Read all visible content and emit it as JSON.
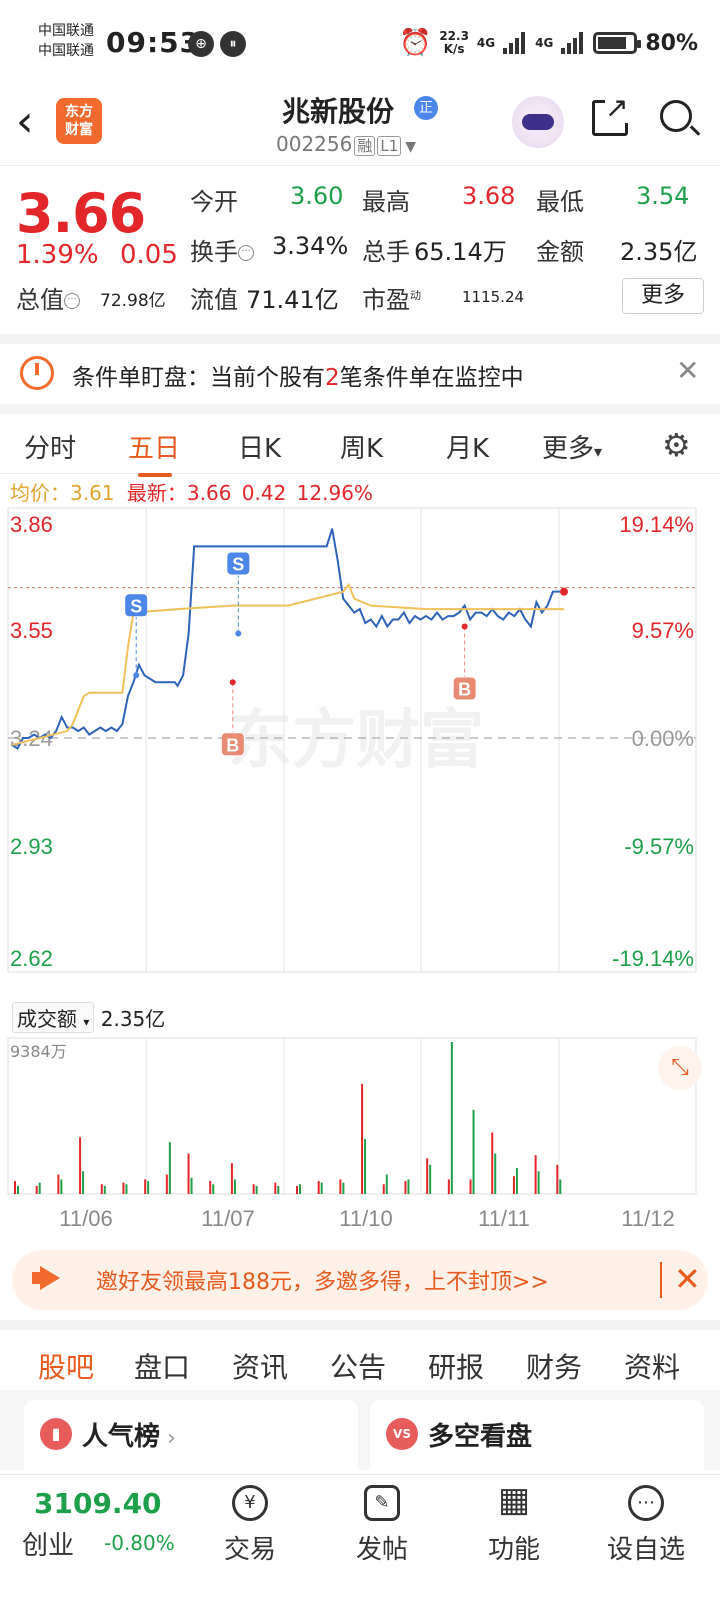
{
  "status_bar": {
    "carrier1": "中国联通",
    "carrier2": "中国联通",
    "time": "09:53",
    "net_speed": "22.3",
    "net_unit": "K/s",
    "sig1": "4G",
    "sig2": "4G",
    "battery": "80%",
    "battery_level": 0.8
  },
  "header": {
    "logo_text_1": "东方",
    "logo_text_2": "财富",
    "stock_name": "兆新股份",
    "badge": "正",
    "stock_code": "002256",
    "tag_rong": "融",
    "tag_level": "L1"
  },
  "quote": {
    "price": "3.66",
    "pct": "1.39%",
    "change": "0.05",
    "open_label": "今开",
    "open": "3.60",
    "high_label": "最高",
    "high": "3.68",
    "low_label": "最低",
    "low": "3.54",
    "turnover_label": "换手",
    "turnover": "3.34%",
    "volume_label": "总手",
    "volume": "65.14万",
    "amount_label": "金额",
    "amount": "2.35亿",
    "mktcap_label": "总值",
    "mktcap": "72.98亿",
    "float_label": "流值",
    "float": "71.41亿",
    "pe_label": "市盈",
    "pe_sup": "动",
    "pe": "1115.24",
    "more": "更多"
  },
  "alert": {
    "prefix": "条件单盯盘：当前个股有",
    "count": "2",
    "suffix": "笔条件单在监控中"
  },
  "tabs": [
    "分时",
    "五日",
    "日K",
    "周K",
    "月K",
    "更多"
  ],
  "tab_more_arrow": "▾",
  "avg_line": {
    "avg_label": "均价：",
    "avg": "3.61",
    "latest_label": "最新：",
    "latest": "3.66",
    "change": "0.42",
    "pct": "12.96%"
  },
  "chart_data": {
    "type": "line",
    "title": "",
    "y_left_ticks": [
      "3.86",
      "3.55",
      "3.24",
      "2.93",
      "2.62"
    ],
    "y_right_ticks": [
      "19.14%",
      "9.57%",
      "0.00%",
      "-9.57%",
      "-19.14%"
    ],
    "x_ticks": [
      "11/06",
      "11/07",
      "11/10",
      "11/11",
      "11/12"
    ],
    "ylim": [
      2.62,
      3.86
    ],
    "base_price": 3.24,
    "watermark": "东方财富",
    "series": [
      {
        "name": "价格",
        "color": "#2d63b8",
        "x": [
          0,
          2,
          4,
          6,
          8,
          10,
          12,
          14,
          16,
          18,
          20,
          22,
          24,
          26,
          28,
          30,
          32,
          34,
          36,
          38,
          40,
          42,
          44,
          46,
          48,
          50,
          52,
          54,
          56,
          57,
          58,
          59,
          60,
          62,
          64,
          66,
          68,
          70,
          72,
          74,
          76,
          78,
          80,
          82,
          84,
          86,
          88,
          90,
          92,
          94,
          96,
          98,
          100,
          102,
          104,
          106,
          108,
          110,
          112,
          114,
          116,
          118,
          120,
          122,
          124,
          126,
          128,
          130,
          132,
          134,
          136,
          138,
          140,
          142,
          144,
          146,
          148,
          150,
          152,
          154,
          156,
          158,
          160,
          162,
          164,
          166,
          168,
          170,
          172,
          174,
          176,
          178,
          180,
          182,
          184,
          186,
          188,
          190,
          192,
          194,
          196,
          198,
          200
        ],
        "values": [
          3.22,
          3.21,
          3.24,
          3.24,
          3.25,
          3.24,
          3.25,
          3.24,
          3.26,
          3.3,
          3.27,
          3.27,
          3.26,
          3.27,
          3.25,
          3.26,
          3.27,
          3.26,
          3.27,
          3.26,
          3.28,
          3.36,
          3.4,
          3.45,
          3.42,
          3.41,
          3.4,
          3.4,
          3.4,
          3.4,
          3.4,
          3.4,
          3.39,
          3.42,
          3.54,
          3.79,
          3.79,
          3.79,
          3.79,
          3.79,
          3.79,
          3.79,
          3.79,
          3.79,
          3.79,
          3.79,
          3.79,
          3.79,
          3.79,
          3.79,
          3.79,
          3.79,
          3.79,
          3.79,
          3.79,
          3.79,
          3.79,
          3.79,
          3.79,
          3.79,
          3.84,
          3.75,
          3.64,
          3.62,
          3.6,
          3.61,
          3.57,
          3.58,
          3.56,
          3.59,
          3.56,
          3.58,
          3.58,
          3.6,
          3.57,
          3.59,
          3.58,
          3.59,
          3.58,
          3.6,
          3.58,
          3.59,
          3.59,
          3.6,
          3.62,
          3.58,
          3.6,
          3.6,
          3.59,
          3.61,
          3.59,
          3.58,
          3.6,
          3.59,
          3.61,
          3.58,
          3.56,
          3.63,
          3.6,
          3.62,
          3.66,
          3.66,
          3.66
        ]
      },
      {
        "name": "均价",
        "color": "#f0c05a",
        "x": [
          0,
          20,
          22,
          24,
          26,
          28,
          40,
          42,
          44,
          60,
          80,
          100,
          120,
          122,
          124,
          130,
          150,
          170,
          190,
          200
        ],
        "values": [
          3.22,
          3.26,
          3.28,
          3.32,
          3.36,
          3.37,
          3.37,
          3.5,
          3.6,
          3.61,
          3.62,
          3.62,
          3.66,
          3.68,
          3.64,
          3.62,
          3.61,
          3.61,
          3.61,
          3.61
        ]
      }
    ],
    "markers": [
      {
        "label": "S",
        "type": "sell",
        "x": 45,
        "price": 3.42
      },
      {
        "label": "B",
        "type": "buy",
        "x": 80,
        "price": 3.4
      },
      {
        "label": "S",
        "type": "sell",
        "x": 82,
        "price": 3.54
      },
      {
        "label": "B",
        "type": "buy",
        "x": 164,
        "price": 3.56
      }
    ],
    "latest_ref_price": 3.66,
    "volume": {
      "label": "成交额",
      "total": "2.35亿",
      "max_label": "9384万",
      "max": 9384,
      "bars_note": "",
      "values_red": [
        800,
        500,
        1200,
        3500,
        600,
        700,
        900,
        1200,
        2500,
        800,
        1900,
        600,
        700,
        500,
        800,
        900,
        6800,
        600,
        800,
        2200,
        900,
        900,
        3800,
        1100,
        2400,
        1800
      ],
      "values_green": [
        500,
        700,
        900,
        1400,
        500,
        600,
        800,
        3200,
        1000,
        600,
        900,
        500,
        500,
        600,
        700,
        700,
        3400,
        1200,
        900,
        1800,
        9384,
        5200,
        2500,
        1600,
        1400,
        900
      ]
    }
  },
  "invite": {
    "text": "邀好友领最高188元，多邀多得，上不封顶>>",
    "close": "✕"
  },
  "subtabs": [
    "股吧",
    "盘口",
    "资讯",
    "公告",
    "研报",
    "财务",
    "资料"
  ],
  "cards": {
    "left_title": "人气榜",
    "left_icon": "bar",
    "right_title": "多空看盘",
    "right_icon": "VS"
  },
  "bottom_nav": {
    "index_value": "3109.40",
    "index_name": "创业",
    "index_pct": "-0.80%",
    "items": [
      {
        "label": "交易",
        "icon": "¥"
      },
      {
        "label": "发帖",
        "icon": "✎"
      },
      {
        "label": "功能",
        "icon": "▦"
      },
      {
        "label": "设自选",
        "icon": "⋯"
      }
    ]
  }
}
